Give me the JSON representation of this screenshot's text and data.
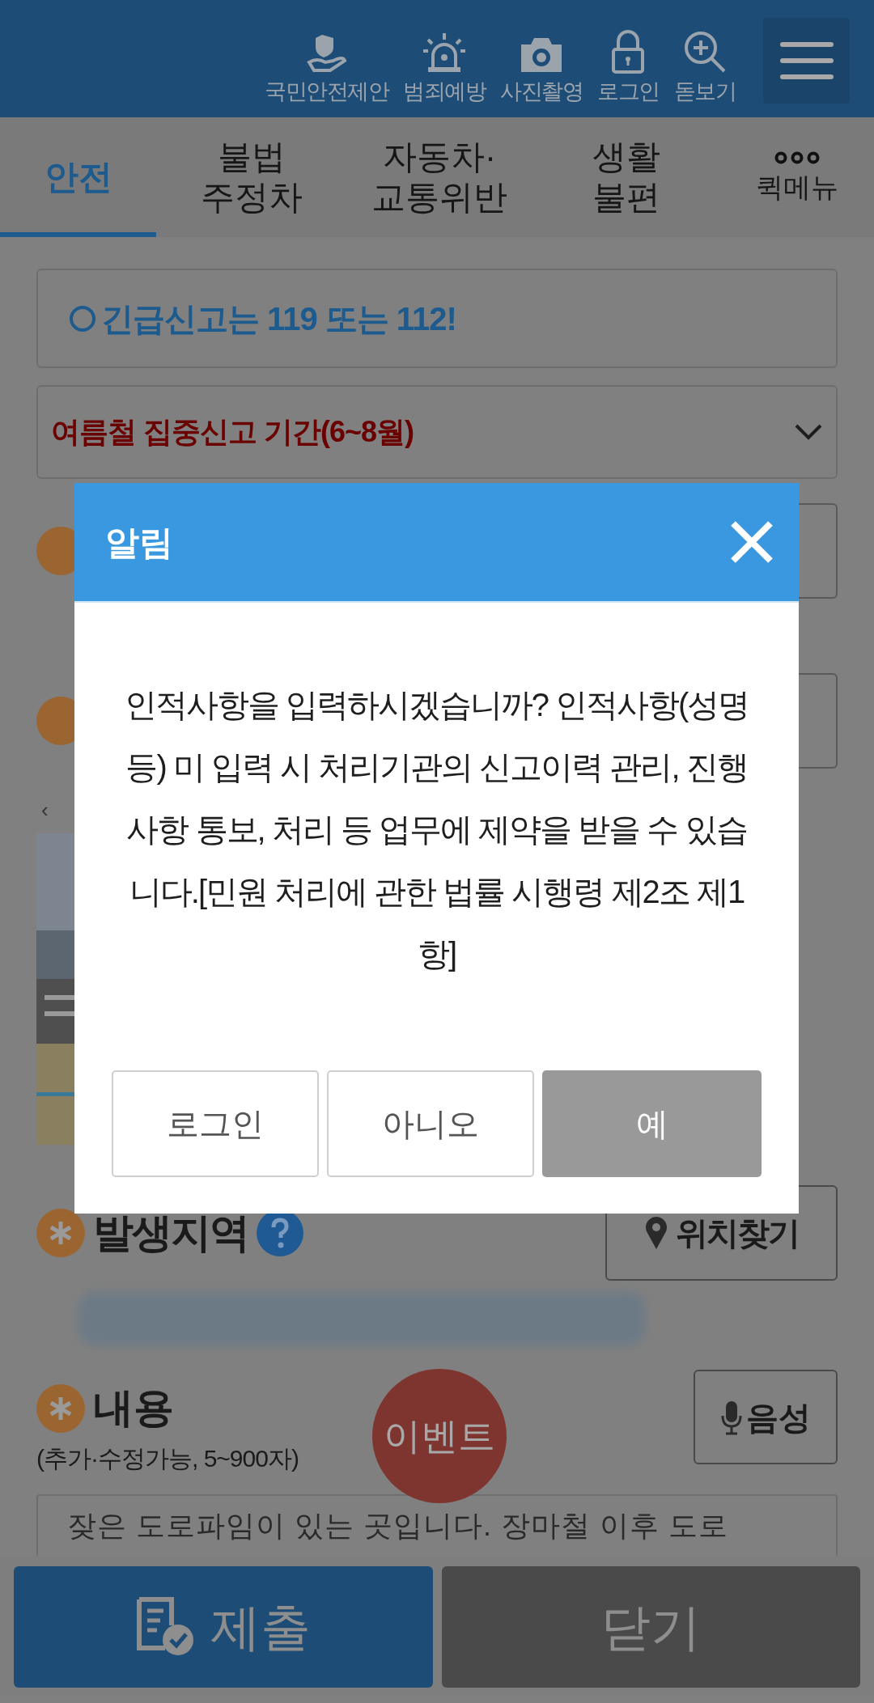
{
  "header": {
    "icons": [
      {
        "kind": "proposal",
        "label": "국민안전제안"
      },
      {
        "kind": "siren",
        "label": "범죄예방"
      },
      {
        "kind": "camera",
        "label": "사진촬영"
      },
      {
        "kind": "lock",
        "label": "로그인"
      },
      {
        "kind": "zoom",
        "label": "돋보기"
      }
    ]
  },
  "tabs": [
    {
      "kind": "text",
      "lines": [
        "안전"
      ],
      "selected": true
    },
    {
      "kind": "text",
      "lines": [
        "불법",
        "주정차"
      ],
      "selected": false
    },
    {
      "kind": "text",
      "lines": [
        "자동차·",
        "교통위반"
      ],
      "selected": false
    },
    {
      "kind": "text",
      "lines": [
        "생활",
        "불편"
      ],
      "selected": false
    },
    {
      "kind": "more",
      "lines": [
        "퀵메뉴"
      ],
      "selected": false
    }
  ],
  "notice": {
    "text": "긴급신고는 119 또는 112!"
  },
  "campaign_select": {
    "value": "여름철 집중신고 기간(6~8월)"
  },
  "photo_nav": "‹",
  "location": {
    "label": "발생지역",
    "button": "위치찾기"
  },
  "content": {
    "label": "내용",
    "hint": "(추가·수정가능, 5~900자)",
    "voice_button": "음성",
    "value": "잦은 도로파임이 있는 곳입니다. 장마철 이후 도로"
  },
  "event_button": "이벤트",
  "bottom_buttons": [
    {
      "kind": "submit",
      "label": "제출"
    },
    {
      "kind": "close",
      "label": "닫기"
    }
  ],
  "dialog": {
    "title": "알림",
    "message": "인적사항을 입력하시겠습니까? 인적사항(성명 등) 미 입력 시 처리기관의 신고이력 관리, 진행사항 통보, 처리 등 업무에 제약을 받을 수 있습니다.[민원 처리에 관한 법률 시행령 제2조 제1항]",
    "buttons": [
      {
        "kind": "outline",
        "label": "로그인"
      },
      {
        "kind": "outline",
        "label": "아니오"
      },
      {
        "kind": "filled",
        "label": "예"
      }
    ]
  }
}
